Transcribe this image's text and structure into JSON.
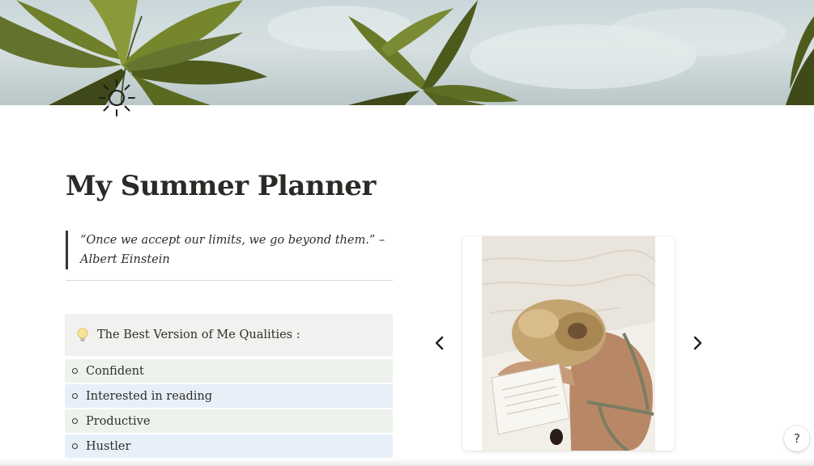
{
  "page": {
    "title": "My Summer Planner",
    "cover": {
      "description_icon": "palm-trees-cover-image"
    },
    "page_icon": "sun-icon"
  },
  "quote": {
    "text": "“Once we accept our limits, we go beyond them.” – Albert Einstein"
  },
  "callout": {
    "icon": "lightbulb-icon",
    "text": "The Best Version of Me Qualities :"
  },
  "qualities": [
    {
      "label": "Confident",
      "color": "#edf3ec"
    },
    {
      "label": "Interested in reading",
      "color": "#e7f0f8"
    },
    {
      "label": "Productive",
      "color": "#edf3ec"
    },
    {
      "label": "Hustler",
      "color": "#e7f0f8"
    }
  ],
  "carousel": {
    "prev_icon": "chevron-left-icon",
    "next_icon": "chevron-right-icon",
    "image": "woman-reading-on-beach-photo"
  },
  "help": {
    "label": "?"
  }
}
